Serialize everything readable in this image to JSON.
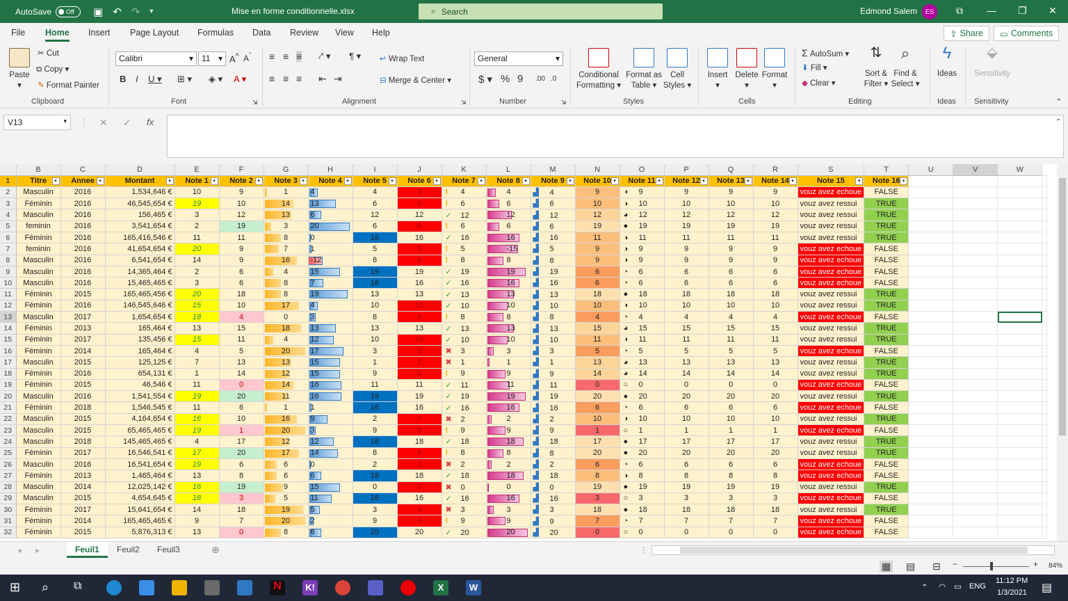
{
  "titlebar": {
    "autosave": "AutoSave",
    "toggle": "Off",
    "filename": "Mise en forme conditionnelle.xlsx",
    "search": "Search",
    "user": "Edmond Salem",
    "initials": "ES"
  },
  "menu": [
    "File",
    "Home",
    "Insert",
    "Page Layout",
    "Formulas",
    "Data",
    "Review",
    "View",
    "Help"
  ],
  "share": "Share",
  "comments": "Comments",
  "ribbon": {
    "paste": "Paste",
    "cut": "Cut",
    "copy": "Copy",
    "format_painter": "Format Painter",
    "clipboard": "Clipboard",
    "font_name": "Calibri",
    "font_size": "11",
    "font": "Font",
    "wrap": "Wrap Text",
    "merge": "Merge & Center",
    "alignment": "Alignment",
    "numfmt": "General",
    "number": "Number",
    "cond": "Conditional Formatting",
    "fmt_table": "Format as Table",
    "cell_styles": "Cell Styles",
    "styles": "Styles",
    "insert": "Insert",
    "delete": "Delete",
    "format": "Format",
    "cells": "Cells",
    "autosum": "AutoSum",
    "fill": "Fill",
    "clear": "Clear",
    "sort": "Sort & Filter",
    "find": "Find & Select",
    "editing": "Editing",
    "ideas": "Ideas",
    "ideas_grp": "Ideas",
    "sensitivity": "Sensitivity",
    "sensitivity_grp": "Sensitivity"
  },
  "namebox": "V13",
  "columns": [
    "",
    "B",
    "C",
    "D",
    "E",
    "F",
    "G",
    "H",
    "I",
    "J",
    "K",
    "L",
    "M",
    "N",
    "O",
    "P",
    "Q",
    "R",
    "S",
    "T",
    "U",
    "V",
    "W"
  ],
  "headers": [
    "Titre",
    "Annee",
    "Montant",
    "Note 1",
    "Note 2",
    "Note 3",
    "Note 4",
    "Note 5",
    "Note 6",
    "Note 7",
    "Note 8",
    "Note 9",
    "Note 10",
    "Note 11",
    "Note 12",
    "Note 13",
    "Note 14",
    "Note 15",
    "Note 16"
  ],
  "rows": [
    [
      "Masculin",
      "2016",
      "1,534,646 €",
      "10",
      "9",
      "1",
      "4",
      "4",
      "4",
      "4",
      "4",
      "4",
      "9",
      "9",
      "9",
      "9",
      "9",
      "vouz avez echoue",
      "FALSE"
    ],
    [
      "Féminin",
      "2016",
      "46,545,654 €",
      "19",
      "10",
      "14",
      "13",
      "6",
      "6",
      "6",
      "6",
      "6",
      "10",
      "10",
      "10",
      "10",
      "10",
      "vouz avez ressui",
      "TRUE"
    ],
    [
      "Masculin",
      "2016",
      "156,465 €",
      "3",
      "12",
      "13",
      "6",
      "12",
      "12",
      "12",
      "12",
      "12",
      "12",
      "12",
      "12",
      "12",
      "12",
      "vouz avez ressui",
      "TRUE"
    ],
    [
      "feminin",
      "2016",
      "3,541,654 €",
      "2",
      "19",
      "3",
      "20",
      "6",
      "6",
      "6",
      "6",
      "6",
      "19",
      "19",
      "19",
      "19",
      "19",
      "vouz avez ressui",
      "TRUE"
    ],
    [
      "Féminin",
      "2016",
      "165,416,546 €",
      "11",
      "11",
      "8",
      "0",
      "16",
      "16",
      "16",
      "16",
      "16",
      "11",
      "11",
      "11",
      "11",
      "11",
      "vouz avez ressui",
      "TRUE"
    ],
    [
      "feminin",
      "2016",
      "41,654,654 €",
      "20",
      "9",
      "7",
      "1",
      "5",
      "5",
      "5",
      "-15",
      "5",
      "9",
      "9",
      "9",
      "9",
      "9",
      "vouz avez echoue",
      "FALSE"
    ],
    [
      "Masculin",
      "2016",
      "6,541,654 €",
      "14",
      "9",
      "16",
      "-12",
      "8",
      "8",
      "8",
      "8",
      "8",
      "9",
      "9",
      "9",
      "9",
      "9",
      "vouz avez echoue",
      "FALSE"
    ],
    [
      "Masculin",
      "2016",
      "14,365,464 €",
      "2",
      "6",
      "4",
      "15",
      "19",
      "19",
      "19",
      "19",
      "19",
      "6",
      "6",
      "6",
      "6",
      "6",
      "vouz avez echoue",
      "FALSE"
    ],
    [
      "Masculin",
      "2016",
      "15,465,465 €",
      "3",
      "6",
      "8",
      "7",
      "16",
      "16",
      "16",
      "16",
      "16",
      "6",
      "6",
      "6",
      "6",
      "6",
      "vouz avez echoue",
      "FALSE"
    ],
    [
      "Féminin",
      "2015",
      "165,465,456 €",
      "20",
      "18",
      "8",
      "19",
      "13",
      "13",
      "13",
      "13",
      "13",
      "18",
      "18",
      "18",
      "18",
      "18",
      "vouz avez ressui",
      "TRUE"
    ],
    [
      "Féminin",
      "2016",
      "146,545,646 €",
      "15",
      "10",
      "17",
      "4",
      "10",
      "10",
      "10",
      "10",
      "10",
      "10",
      "10",
      "10",
      "10",
      "10",
      "vouz avez ressui",
      "TRUE"
    ],
    [
      "Masculin",
      "2017",
      "1,654,654 €",
      "18",
      "4",
      "0",
      "3",
      "8",
      "8",
      "8",
      "8",
      "8",
      "4",
      "4",
      "4",
      "4",
      "4",
      "vouz avez echoue",
      "FALSE"
    ],
    [
      "Féminin",
      "2013",
      "165,464 €",
      "13",
      "15",
      "18",
      "13",
      "13",
      "13",
      "13",
      "13",
      "13",
      "15",
      "15",
      "15",
      "15",
      "15",
      "vouz avez ressui",
      "TRUE"
    ],
    [
      "Féminin",
      "2017",
      "135,456 €",
      "15",
      "11",
      "4",
      "12",
      "10",
      "10",
      "10",
      "10",
      "10",
      "11",
      "11",
      "11",
      "11",
      "11",
      "vouz avez ressui",
      "TRUE"
    ],
    [
      "Féminin",
      "2014",
      "165,464 €",
      "4",
      "5",
      "20",
      "17",
      "3",
      "3",
      "3",
      "3",
      "3",
      "5",
      "5",
      "5",
      "5",
      "5",
      "vouz avez echoue",
      "FALSE"
    ],
    [
      "Masculin",
      "2015",
      "125,125 €",
      "7",
      "13",
      "13",
      "15",
      "1",
      "1",
      "1",
      "1",
      "1",
      "13",
      "13",
      "13",
      "13",
      "13",
      "vouz avez ressui",
      "TRUE"
    ],
    [
      "Féminin",
      "2016",
      "654,131 €",
      "1",
      "14",
      "12",
      "15",
      "9",
      "9",
      "9",
      "9",
      "9",
      "14",
      "14",
      "14",
      "14",
      "14",
      "vouz avez ressui",
      "TRUE"
    ],
    [
      "Féminin",
      "2015",
      "46,546 €",
      "11",
      "0",
      "14",
      "16",
      "11",
      "11",
      "11",
      "11",
      "11",
      "0",
      "0",
      "0",
      "0",
      "0",
      "vouz avez echoue",
      "FALSE"
    ],
    [
      "Masculin",
      "2016",
      "1,541,554 €",
      "19",
      "20",
      "11",
      "16",
      "19",
      "19",
      "19",
      "19",
      "19",
      "20",
      "20",
      "20",
      "20",
      "20",
      "vouz avez ressui",
      "TRUE"
    ],
    [
      "Féminin",
      "2018",
      "1,546,545 €",
      "11",
      "6",
      "1",
      "1",
      "16",
      "16",
      "16",
      "16",
      "16",
      "6",
      "6",
      "6",
      "6",
      "6",
      "vouz avez echoue",
      "FALSE"
    ],
    [
      "Masculin",
      "2015",
      "4,164,654 €",
      "16",
      "10",
      "16",
      "9",
      "2",
      "2",
      "2",
      "2",
      "2",
      "10",
      "10",
      "10",
      "10",
      "10",
      "vouz avez ressui",
      "TRUE"
    ],
    [
      "Masculin",
      "2015",
      "65,465,465 €",
      "19",
      "1",
      "20",
      "3",
      "9",
      "9",
      "9",
      "9",
      "9",
      "1",
      "1",
      "1",
      "1",
      "1",
      "vouz avez echoue",
      "FALSE"
    ],
    [
      "Masculin",
      "2018",
      "145,465,465 €",
      "4",
      "17",
      "12",
      "12",
      "18",
      "18",
      "18",
      "18",
      "18",
      "17",
      "17",
      "17",
      "17",
      "17",
      "vouz avez ressui",
      "TRUE"
    ],
    [
      "Féminin",
      "2017",
      "16,546,541 €",
      "17",
      "20",
      "17",
      "14",
      "8",
      "8",
      "8",
      "8",
      "8",
      "20",
      "20",
      "20",
      "20",
      "20",
      "vouz avez ressui",
      "TRUE"
    ],
    [
      "Masculin",
      "2016",
      "16,541,654 €",
      "19",
      "6",
      "6",
      "0",
      "2",
      "2",
      "2",
      "2",
      "2",
      "6",
      "6",
      "6",
      "6",
      "6",
      "vouz avez echoue",
      "FALSE"
    ],
    [
      "Féminin",
      "2013",
      "1,465,464 €",
      "13",
      "8",
      "6",
      "6",
      "18",
      "18",
      "18",
      "18",
      "18",
      "8",
      "8",
      "8",
      "8",
      "8",
      "vouz avez echoue",
      "FALSE"
    ],
    [
      "Masculin",
      "2014",
      "12,025,142 €",
      "16",
      "19",
      "9",
      "15",
      "0",
      "0",
      "0",
      "0",
      "0",
      "19",
      "19",
      "19",
      "19",
      "19",
      "vouz avez ressui",
      "TRUE"
    ],
    [
      "Masculin",
      "2015",
      "4,654,645 €",
      "18",
      "3",
      "5",
      "11",
      "16",
      "16",
      "16",
      "16",
      "16",
      "3",
      "3",
      "3",
      "3",
      "3",
      "vouz avez echoue",
      "FALSE"
    ],
    [
      "Féminin",
      "2017",
      "15,641,654 €",
      "14",
      "18",
      "19",
      "5",
      "3",
      "3",
      "3",
      "3",
      "3",
      "18",
      "18",
      "18",
      "18",
      "18",
      "vouz avez ressui",
      "TRUE"
    ],
    [
      "Féminin",
      "2014",
      "165,465,465 €",
      "9",
      "7",
      "20",
      "2",
      "9",
      "9",
      "9",
      "9",
      "9",
      "7",
      "7",
      "7",
      "7",
      "7",
      "vouz avez echoue",
      "FALSE"
    ],
    [
      "Féminin",
      "2015",
      "5,876,313 €",
      "13",
      "0",
      "8",
      "6",
      "20",
      "20",
      "20",
      "20",
      "20",
      "0",
      "0",
      "0",
      "0",
      "0",
      "vouz avez echoue",
      "FALSE"
    ]
  ],
  "sheets": [
    "Feuil1",
    "Feuil2",
    "Feuil3"
  ],
  "zoom": "84%",
  "clock": {
    "time": "11:12 PM",
    "date": "1/3/2021"
  },
  "lang": "ENG",
  "colors": {
    "excel_green": "#217346",
    "header_fill": "#ffc000",
    "row_fill": "#fff2cc",
    "red": "#ff0000",
    "yellow": "#ffff00",
    "blue": "#0070c0",
    "true_fill": "#92d050"
  }
}
